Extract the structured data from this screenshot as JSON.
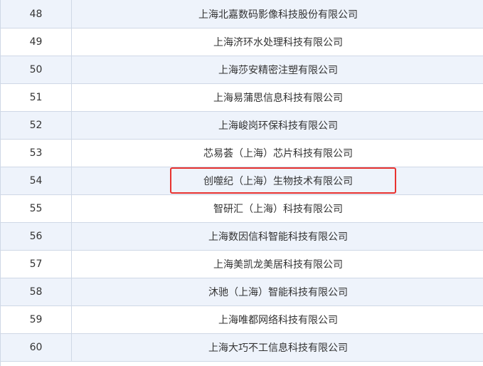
{
  "table": {
    "rows": [
      {
        "num": "48",
        "name": "上海北嘉数码影像科技股份有限公司"
      },
      {
        "num": "49",
        "name": "上海济环水处理科技有限公司"
      },
      {
        "num": "50",
        "name": "上海莎安精密注塑有限公司"
      },
      {
        "num": "51",
        "name": "上海易蒲思信息科技有限公司"
      },
      {
        "num": "52",
        "name": "上海峻岗环保科技有限公司"
      },
      {
        "num": "53",
        "name": "芯易荟（上海）芯片科技有限公司"
      },
      {
        "num": "54",
        "name": "创噬纪（上海）生物技术有限公司"
      },
      {
        "num": "55",
        "name": "智研汇（上海）科技有限公司"
      },
      {
        "num": "56",
        "name": "上海数因信科智能科技有限公司"
      },
      {
        "num": "57",
        "name": "上海美凯龙美居科技有限公司"
      },
      {
        "num": "58",
        "name": "沐驰（上海）智能科技有限公司"
      },
      {
        "num": "59",
        "name": "上海唯都网络科技有限公司"
      },
      {
        "num": "60",
        "name": "上海大巧不工信息科技有限公司"
      }
    ]
  },
  "colors": {
    "stripe": "#eef3fb",
    "border": "#cfd8e6",
    "highlight": "#e8322f"
  }
}
